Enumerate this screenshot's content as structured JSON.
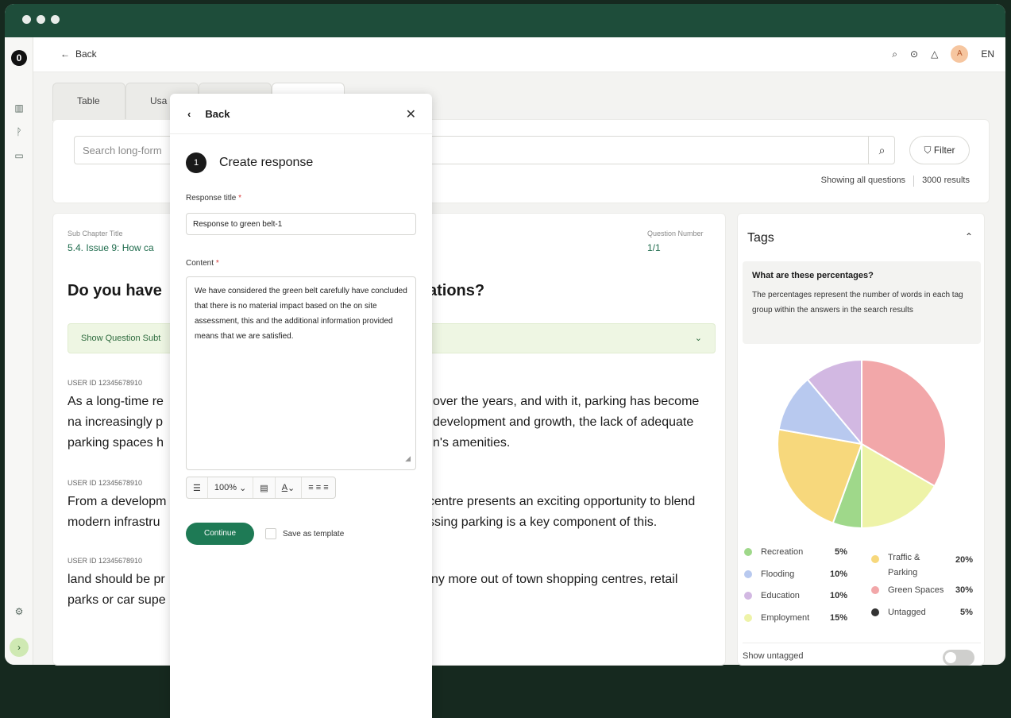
{
  "nav": {
    "back_label": "Back",
    "language": "EN",
    "avatar_initial": "A"
  },
  "tabs": [
    {
      "label": "Table"
    },
    {
      "label": "Usa"
    },
    {
      "label": ""
    },
    {
      "label": ""
    }
  ],
  "search": {
    "placeholder": "Search long-form",
    "filter_label": "Filter",
    "showing_label": "Showing all questions",
    "results_label": "3000 results"
  },
  "main": {
    "sub_chapter_label": "Sub Chapter Title",
    "sub_chapter_value": "5.4. Issue 9: How ca",
    "question_number_label": "Question Number",
    "question_number_value": "1/1",
    "question_heading_left": "Do you have",
    "question_heading_right": "ations?",
    "show_subtext_label": "Show Question Subt",
    "responses": [
      {
        "user_id": "USER ID 12345678910",
        "left_lines": [
          "As a long-time re",
          "na increasingly p",
          "parking spaces h"
        ],
        "right_lines": [
          "over the years, and with it, parking has become",
          "development and growth, the lack of adequate",
          "n's amenities."
        ]
      },
      {
        "user_id": "USER ID 12345678910",
        "left_lines": [
          "From a developm",
          "modern infrastru"
        ],
        "right_lines": [
          "centre presents an exciting opportunity to blend",
          "ssing parking is a key component of this."
        ]
      },
      {
        "user_id": "USER ID 12345678910",
        "left_lines": [
          "land should be pr",
          "parks or car supe"
        ],
        "right_lines": [
          "ny more out of town shopping centres, retail",
          ""
        ]
      }
    ]
  },
  "tags": {
    "title": "Tags",
    "info_heading": "What are these percentages?",
    "info_text": "The percentages represent the number of words in each tag group within the answers in the search results",
    "show_untagged_label": "Show untagged",
    "items": [
      {
        "label": "Recreation",
        "pct": "5%",
        "value": 5,
        "color": "#9fd88a"
      },
      {
        "label": "Flooding",
        "pct": "10%",
        "value": 10,
        "color": "#b8c9ef"
      },
      {
        "label": "Education",
        "pct": "10%",
        "value": 10,
        "color": "#d2b8e2"
      },
      {
        "label": "Employment",
        "pct": "15%",
        "value": 15,
        "color": "#eef3a8"
      },
      {
        "label": "Traffic & Parking",
        "pct": "20%",
        "value": 20,
        "color": "#f7d87c"
      },
      {
        "label": "Green Spaces",
        "pct": "30%",
        "value": 30,
        "color": "#f2a7a9"
      },
      {
        "label": "Untagged",
        "pct": "5%",
        "value": 5,
        "color": "#333333"
      }
    ]
  },
  "modal": {
    "back_label": "Back",
    "step_number": "1",
    "step_title": "Create response",
    "response_title_label": "Response title",
    "response_title_value": "Response to green belt-1",
    "content_label": "Content",
    "content_value": "We have considered the green belt carefully have concluded that there is no material impact based on the on site assessment, this and the additional information provided means that we are satisfied.",
    "zoom_value": "100%",
    "continue_label": "Continue",
    "save_template_label": "Save as template"
  }
}
